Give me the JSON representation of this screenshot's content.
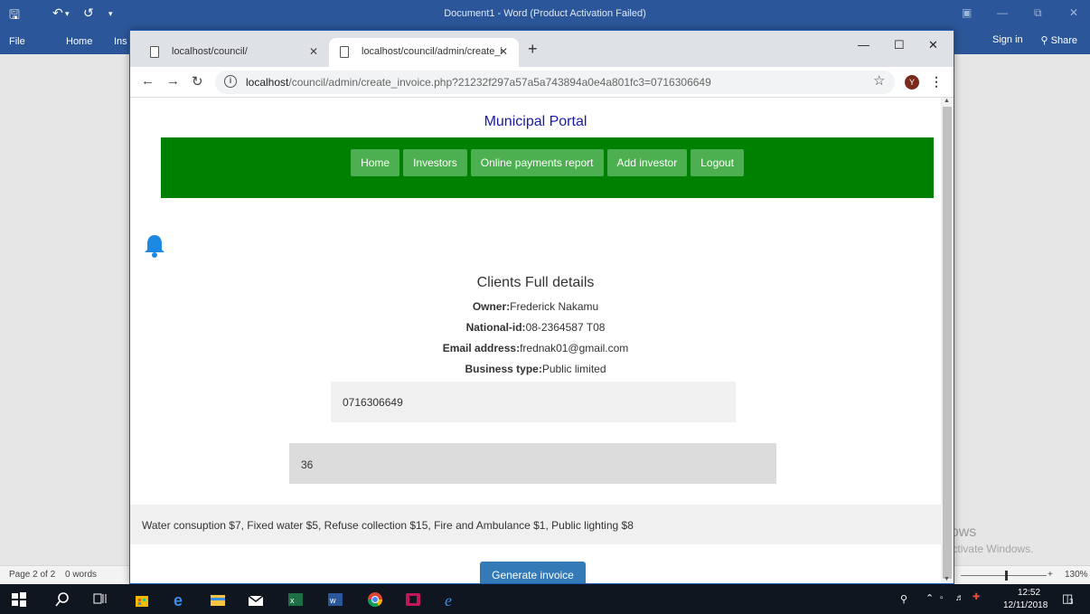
{
  "word": {
    "title": "Document1 - Word (Product Activation Failed)",
    "tabs": [
      "File",
      "Home",
      "Ins"
    ],
    "sign_in": "Sign in",
    "share": "Share",
    "status": {
      "page": "Page 2 of 2",
      "words": "0 words",
      "zoom": "130%",
      "zoom_level": 1.3
    }
  },
  "activation": {
    "title": "Activate Windows",
    "subtitle": "Go to Settings to activate Windows."
  },
  "browser": {
    "tabs": [
      {
        "title": "localhost/council/",
        "active": false
      },
      {
        "title": "localhost/council/admin/create_i",
        "active": true
      }
    ],
    "url_host": "localhost",
    "url_path": "/council/admin/create_invoice.php?21232f297a57a5a743894a0e4a801fc3=0716306649",
    "profile_initial": "Y"
  },
  "page": {
    "portal_title": "Municipal Portal",
    "nav": [
      "Home",
      "Investors",
      "Online payments report",
      "Add investor",
      "Logout"
    ],
    "section_title": "Clients Full details",
    "details": [
      {
        "label": "Owner:",
        "value": "Frederick Nakamu"
      },
      {
        "label": "National-id:",
        "value": "08-2364587 T08"
      },
      {
        "label": "Email address:",
        "value": "frednak01@gmail.com"
      },
      {
        "label": "Business type:",
        "value": "Public limited"
      }
    ],
    "phone_field": "0716306649",
    "number_field": "36",
    "charges": "Water consuption $7, Fixed water $5, Refuse collection $15, Fire and Ambulance $1, Public lighting $8",
    "generate_button": "Generate invoice"
  },
  "taskbar": {
    "time": "12:52",
    "date": "12/11/2018",
    "notifications": "3"
  },
  "colors": {
    "word_blue": "#2b579a",
    "nav_green": "#008000",
    "nav_button": "#4caf50",
    "portal_title": "#1a1aa8",
    "primary_button": "#337ab7",
    "bell": "#1e88e5"
  }
}
